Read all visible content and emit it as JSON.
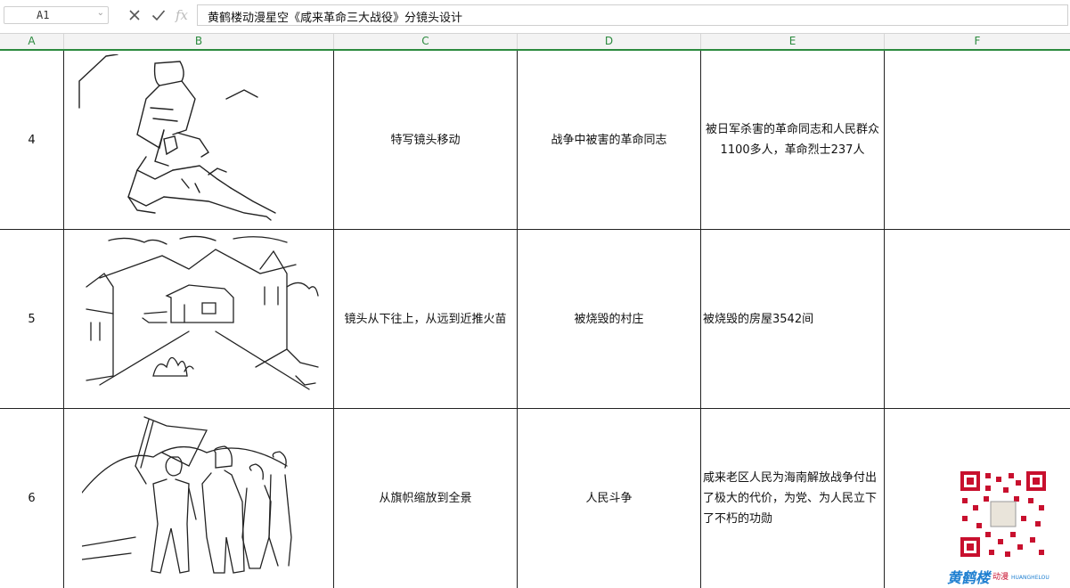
{
  "name_box": {
    "value": "A1"
  },
  "formula_bar": {
    "cancel_icon": "close-icon",
    "confirm_icon": "check-icon",
    "fx_label": "fx",
    "content": "黄鹤楼动漫星空《咸来革命三大战役》分镜头设计"
  },
  "columns": [
    "A",
    "B",
    "C",
    "D",
    "E",
    "F"
  ],
  "rows": [
    {
      "num": "4",
      "camera": "特写镜头移动",
      "scene": "战争中被害的革命同志",
      "note": "被日军杀害的革命同志和人民群众1100多人，革命烈士237人",
      "sketch": "fallen-soldiers-sketch"
    },
    {
      "num": "5",
      "camera": "镜头从下往上，从远到近推火苗",
      "scene": "被烧毁的村庄",
      "note": "被烧毁的房屋3542间",
      "sketch": "burned-village-sketch"
    },
    {
      "num": "6",
      "camera": "从旗帜缩放到全景",
      "scene": "人民斗争",
      "note": "咸来老区人民为海南解放战争付出了极大的代价，为党、为人民立下了不朽的功勋",
      "sketch": "people-struggle-sketch"
    }
  ],
  "watermark": {
    "brand_icon": "qr-code-icon",
    "logo_text": "黄鹤楼",
    "suffix": "动漫",
    "sub": "HUANGHELOU"
  }
}
